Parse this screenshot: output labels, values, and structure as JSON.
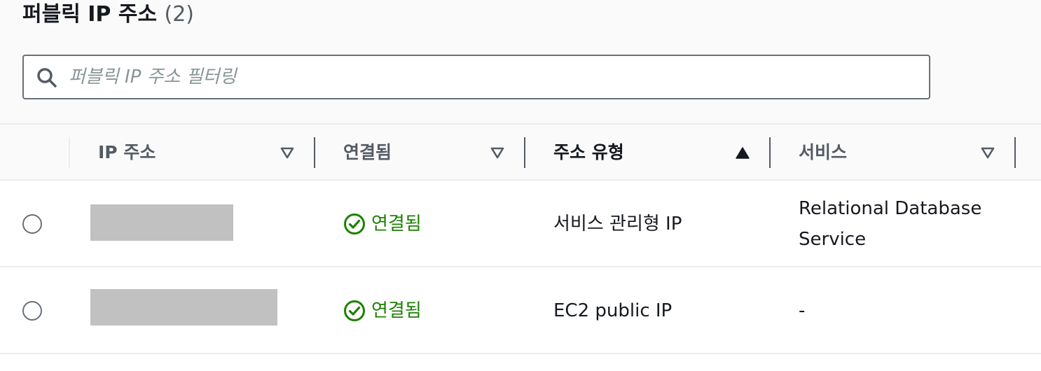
{
  "section": {
    "title": "퍼블릭 IP 주소",
    "count": "(2)"
  },
  "search": {
    "placeholder": "퍼블릭 IP 주소 필터링",
    "value": ""
  },
  "table": {
    "columns": [
      {
        "label": "IP 주소",
        "sort": "sortable"
      },
      {
        "label": "연결됨",
        "sort": "sortable"
      },
      {
        "label": "주소 유형",
        "sort": "ascending"
      },
      {
        "label": "서비스",
        "sort": "sortable"
      }
    ],
    "rows": [
      {
        "ip_address": "",
        "connected": "연결됨",
        "address_type": "서비스 관리형 IP",
        "service": "Relational Database Service"
      },
      {
        "ip_address": "",
        "connected": "연결됨",
        "address_type": "EC2 public IP",
        "service": "-"
      }
    ]
  },
  "colors": {
    "success": "#1d8102",
    "border": "#687078",
    "redaction": "#c1c1c1"
  },
  "icons": {
    "search": "search-icon",
    "sort_down": "caret-down-outline-icon",
    "sort_up": "caret-up-filled-icon",
    "status": "status-check-circle-icon"
  }
}
